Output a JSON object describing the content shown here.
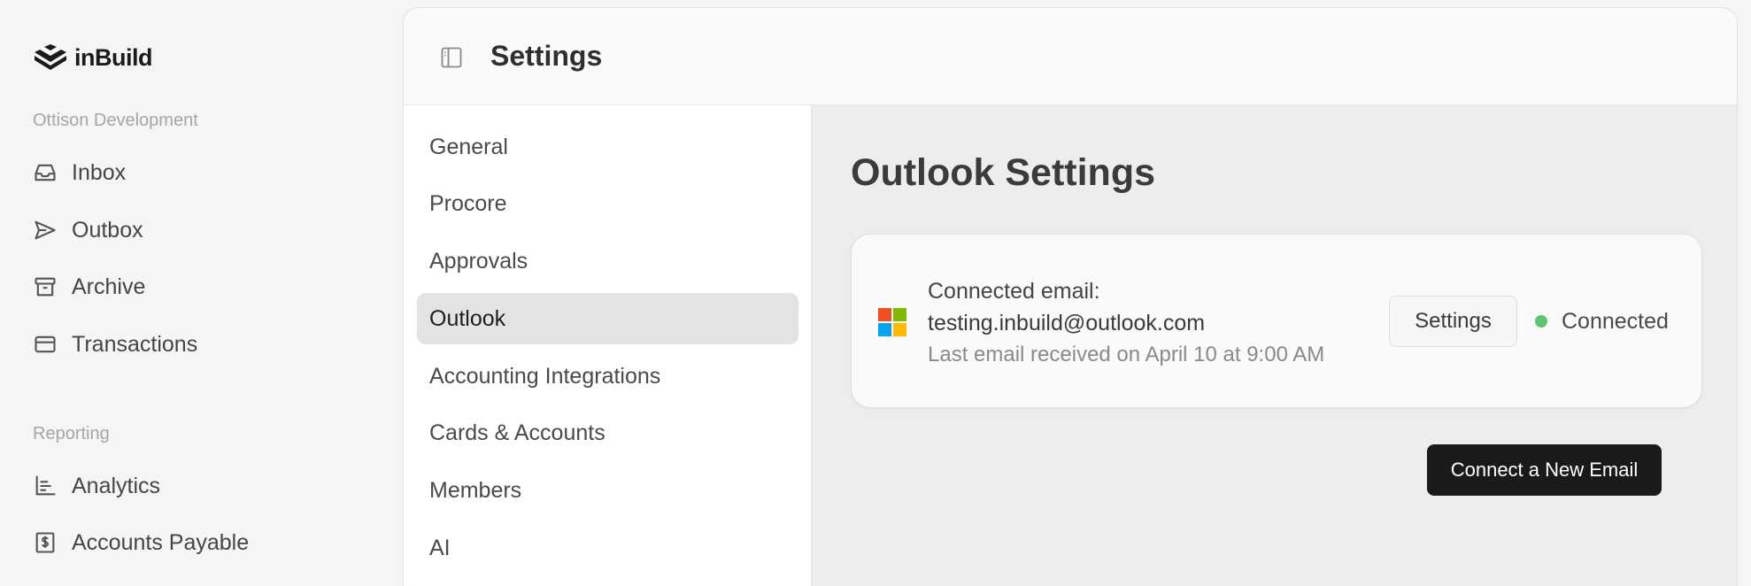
{
  "app": {
    "brand": "inBuild"
  },
  "sidebar": {
    "sections": [
      {
        "title": "Ottison Development",
        "items": [
          {
            "label": "Inbox",
            "icon": "inbox-icon"
          },
          {
            "label": "Outbox",
            "icon": "send-icon"
          },
          {
            "label": "Archive",
            "icon": "archive-icon"
          },
          {
            "label": "Transactions",
            "icon": "credit-card-icon"
          }
        ]
      },
      {
        "title": "Reporting",
        "items": [
          {
            "label": "Analytics",
            "icon": "bar-chart-icon"
          },
          {
            "label": "Accounts Payable",
            "icon": "dollar-receipt-icon"
          }
        ]
      }
    ]
  },
  "header": {
    "title": "Settings",
    "toggle_icon": "sidebar-toggle-icon"
  },
  "settings_nav": {
    "items": [
      {
        "label": "General",
        "active": false
      },
      {
        "label": "Procore",
        "active": false
      },
      {
        "label": "Approvals",
        "active": false
      },
      {
        "label": "Outlook",
        "active": true
      },
      {
        "label": "Accounting Integrations",
        "active": false
      },
      {
        "label": "Cards & Accounts",
        "active": false
      },
      {
        "label": "Members",
        "active": false
      },
      {
        "label": "AI",
        "active": false
      }
    ]
  },
  "outlook": {
    "title": "Outlook Settings",
    "account": {
      "label": "Connected email:",
      "email": "testing.inbuild@outlook.com",
      "last_received": "Last email received on April 10 at 9:00 AM",
      "settings_label": "Settings",
      "status": "Connected",
      "status_color": "#5cc46f",
      "provider_icon": "microsoft-icon",
      "provider_colors": [
        "#f25022",
        "#7fba00",
        "#00a4ef",
        "#ffb900"
      ]
    },
    "connect_label": "Connect a New Email"
  }
}
